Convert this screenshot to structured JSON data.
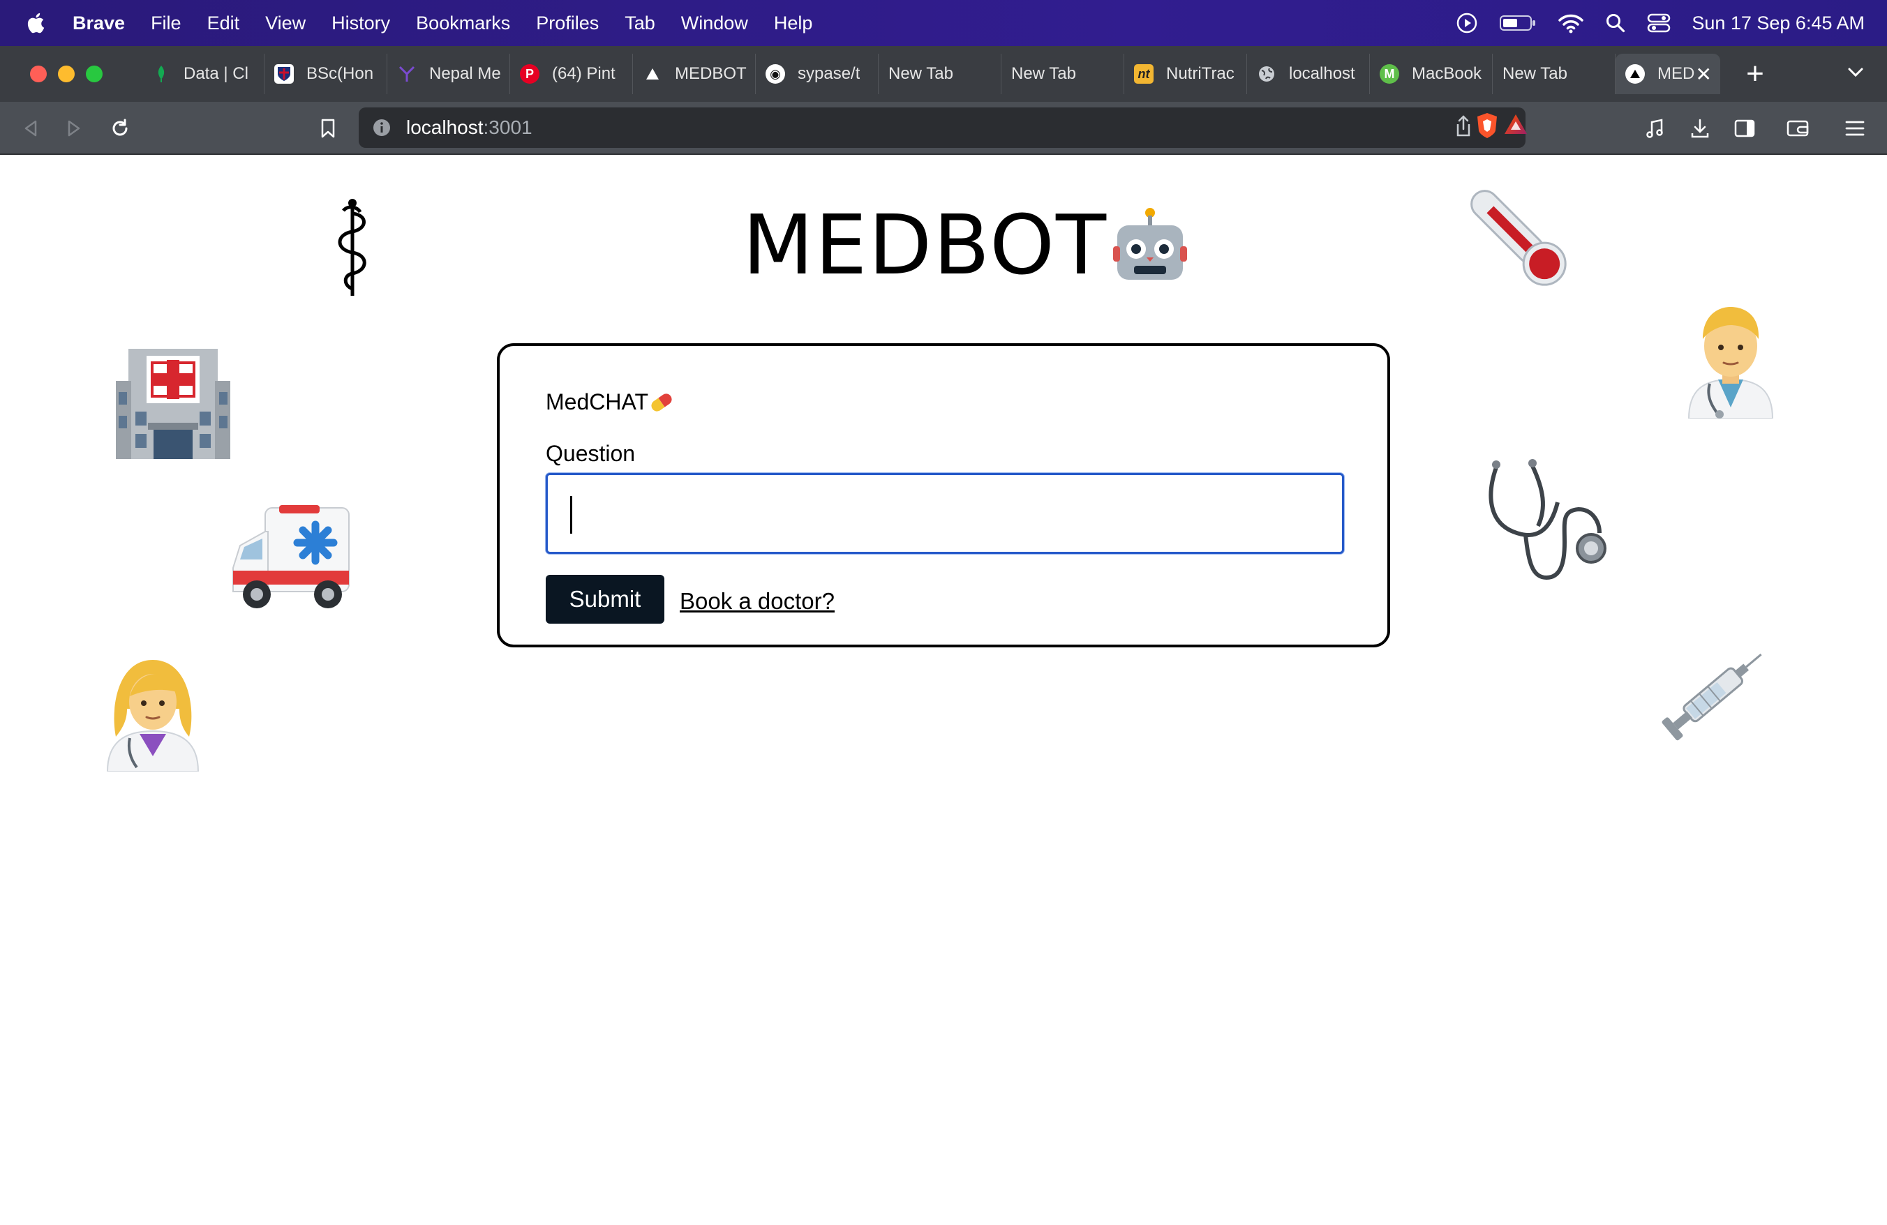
{
  "menubar": {
    "app_name": "Brave",
    "items": [
      "File",
      "Edit",
      "View",
      "History",
      "Bookmarks",
      "Profiles",
      "Tab",
      "Window",
      "Help"
    ],
    "clock": "Sun 17 Sep  6:45 AM",
    "status_icons": [
      "play-circle-icon",
      "battery-icon",
      "wifi-icon",
      "spotlight-search-icon",
      "control-center-icon"
    ]
  },
  "tabs": [
    {
      "title": "Data | Cl",
      "icon": "leaf-icon",
      "color": "#13aa52"
    },
    {
      "title": "BSc(Hon",
      "icon": "shield-crest-icon",
      "color": "#c8102e"
    },
    {
      "title": "Nepal Me",
      "icon": "y-logo-icon",
      "color": "#7a4bd1"
    },
    {
      "title": "(64) Pint",
      "icon": "pinterest-icon",
      "color": "#e60023"
    },
    {
      "title": "MEDBOT",
      "icon": "triangle-icon",
      "color": "#ffffff"
    },
    {
      "title": "sypase/t",
      "icon": "github-icon",
      "color": "#ffffff"
    },
    {
      "title": "New Tab",
      "icon": "",
      "color": ""
    },
    {
      "title": "New Tab",
      "icon": "",
      "color": ""
    },
    {
      "title": "NutriTrac",
      "icon": "nt-logo-icon",
      "color": "#f2b632"
    },
    {
      "title": "localhost",
      "icon": "globe-icon",
      "color": "#c9cdd2"
    },
    {
      "title": "MacBook",
      "icon": "m-logo-icon",
      "color": "#5fbf4a"
    },
    {
      "title": "New Tab",
      "icon": "",
      "color": ""
    }
  ],
  "active_tab": {
    "title": "MED",
    "icon": "triangle-icon"
  },
  "address": {
    "host": "localhost",
    "port": ":3001"
  },
  "page": {
    "title": "MEDBOT",
    "title_emoji": "🤖",
    "card": {
      "heading": "MedCHAT",
      "heading_emoji": "💊",
      "question_label": "Question",
      "question_value": "",
      "submit_label": "Submit",
      "book_link": "Book a doctor?"
    },
    "decorations": [
      "⚕",
      "🌡️",
      "🏥",
      "👨‍⚕️",
      "🩺",
      "🚑",
      "💉",
      "👩‍⚕️"
    ]
  },
  "colors": {
    "menubar": "#2f1c8a",
    "tabstrip": "#3a3d42",
    "toolbar": "#4b4f55",
    "input_focus": "#2559c9",
    "submit_bg": "#0a1622"
  }
}
